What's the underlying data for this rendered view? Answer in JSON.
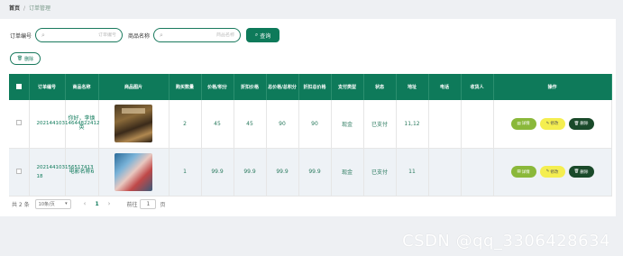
{
  "breadcrumb": {
    "home": "首页",
    "separator": "/",
    "current": "订单管理"
  },
  "search": {
    "order_label": "订单编号",
    "order_placeholder": "订单编号",
    "product_label": "商品名称",
    "product_placeholder": "商品名称",
    "query_button": "查询"
  },
  "toolbar": {
    "delete_label": "删除"
  },
  "table": {
    "headers": [
      "",
      "订单编号",
      "商品名称",
      "商品图片",
      "购买数量",
      "价格/积分",
      "折扣价格",
      "总价格/总积分",
      "折扣总价格",
      "支付类型",
      "状态",
      "地址",
      "电话",
      "收货人",
      "操作"
    ],
    "rows": [
      {
        "code": "20214410314644822412",
        "name": "你好，李焕英",
        "qty": "2",
        "price": "45",
        "discount_price": "45",
        "total": "90",
        "discount_total": "90",
        "pay_type": "现金",
        "status": "已支付",
        "address": "11,12",
        "phone": "",
        "receiver": ""
      },
      {
        "code": "202144103156517413 18",
        "name": "电影名称6",
        "qty": "1",
        "price": "99.9",
        "discount_price": "99.9",
        "total": "99.9",
        "discount_total": "99.9",
        "pay_type": "现金",
        "status": "已支付",
        "address": "11",
        "phone": "",
        "receiver": ""
      }
    ],
    "actions": {
      "detail": "详情",
      "edit": "修改",
      "delete": "删除"
    }
  },
  "pagination": {
    "total": "共 2 条",
    "page_size": "10条/页",
    "prev": "‹",
    "current_page": "1",
    "next": "›",
    "goto_label": "前往",
    "goto_value": "1",
    "page_unit": "页"
  },
  "watermark": "CSDN @qq_3306428634",
  "colors": {
    "primary": "#0e7a5a",
    "detail": "#8ab83a",
    "edit": "#f4ee50",
    "delete": "#1a4a2a"
  }
}
